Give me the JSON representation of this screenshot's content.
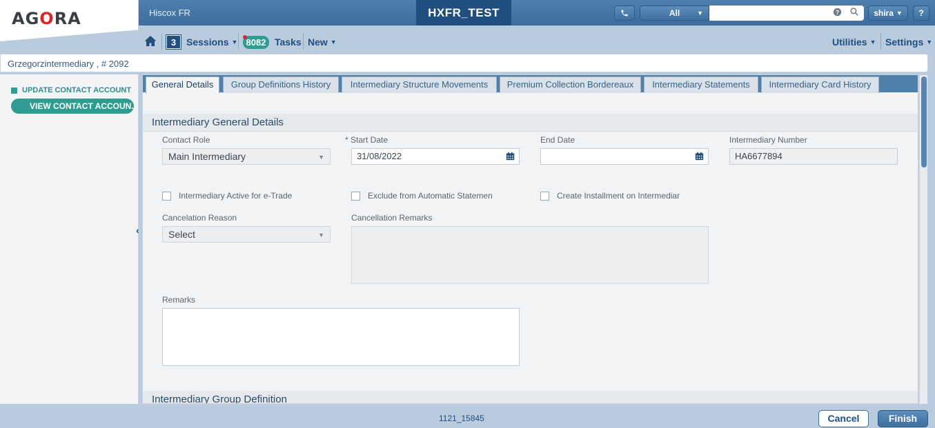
{
  "header": {
    "logo": "AGORA",
    "app_name": "Hiscox FR",
    "environment": "HXFR_TEST",
    "search_scope": "All",
    "search_placeholder": "",
    "user": "shira",
    "help": "?"
  },
  "nav": {
    "sessions_count": "3",
    "sessions_label": "Sessions",
    "tasks_count": "8082",
    "tasks_label": "Tasks",
    "new_label": "New",
    "utilities_label": "Utilities",
    "settings_label": "Settings"
  },
  "breadcrumb": "Grzegorzintermediary , # 2092",
  "sidebar": {
    "items": [
      {
        "label": "UPDATE CONTACT ACCOUNT"
      },
      {
        "label": "VIEW CONTACT ACCOUN..."
      }
    ]
  },
  "tabs": [
    {
      "label": "General Details",
      "active": true
    },
    {
      "label": "Group Definitions History"
    },
    {
      "label": "Intermediary Structure Movements"
    },
    {
      "label": "Premium Collection Bordereaux"
    },
    {
      "label": "Intermediary Statements"
    },
    {
      "label": "Intermediary Card History"
    }
  ],
  "general": {
    "section_title": "Intermediary General Details",
    "contact_role": {
      "label": "Contact Role",
      "value": "Main Intermediary"
    },
    "start_date": {
      "label": "* Start Date",
      "value": "31/08/2022"
    },
    "end_date": {
      "label": "End Date",
      "value": ""
    },
    "intermediary_number": {
      "label": "Intermediary Number",
      "value": "HA6677894"
    },
    "checkboxes": [
      {
        "label": "Intermediary Active for e-Trade",
        "checked": false
      },
      {
        "label": "Exclude from Automatic Statemen",
        "checked": false
      },
      {
        "label": "Create Installment on Intermediar",
        "checked": false
      }
    ],
    "cancelation_reason": {
      "label": "Cancelation Reason",
      "value": "Select"
    },
    "cancellation_remarks": {
      "label": "Cancellation Remarks",
      "value": ""
    },
    "remarks": {
      "label": "Remarks",
      "value": ""
    }
  },
  "group_section_title": "Intermediary Group Definition",
  "footer": {
    "code": "1121_15845",
    "cancel_label": "Cancel",
    "finish_label": "Finish"
  },
  "colors": {
    "header_blue": "#3c6d9e",
    "env_blue": "#1f4e7f",
    "teal_accent": "#2f9c92",
    "logo_red": "#d9262c"
  }
}
